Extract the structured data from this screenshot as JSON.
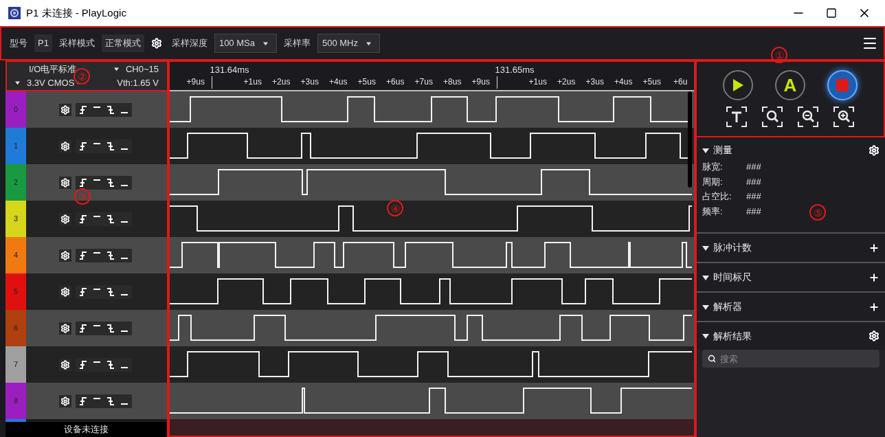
{
  "window": {
    "title": "P1 未连接 - PlayLogic"
  },
  "toolbar": {
    "items": [
      {
        "kind": "label",
        "text": "型号"
      },
      {
        "kind": "value",
        "text": "P1"
      },
      {
        "kind": "label",
        "text": "采样模式"
      },
      {
        "kind": "value",
        "text": "正常模式"
      },
      {
        "kind": "gear"
      },
      {
        "kind": "label",
        "text": "采样深度"
      },
      {
        "kind": "select",
        "text": "100 MSa"
      },
      {
        "kind": "label",
        "text": "采样率"
      },
      {
        "kind": "select",
        "text": "500 MHz"
      }
    ]
  },
  "io_panel": {
    "title": "I/O电平标准",
    "channels": "CH0~15",
    "standard": "3.3V CMOS -",
    "threshold": "Vth:1.65 V"
  },
  "channels": [
    {
      "number": "0",
      "color": "#9b1fc0"
    },
    {
      "number": "1",
      "color": "#1f7ad8"
    },
    {
      "number": "2",
      "color": "#1a9a40"
    },
    {
      "number": "3",
      "color": "#d6d61a"
    },
    {
      "number": "4",
      "color": "#f07a10"
    },
    {
      "number": "5",
      "color": "#e01010"
    },
    {
      "number": "6",
      "color": "#b04010"
    },
    {
      "number": "7",
      "color": "#a0a0a0"
    },
    {
      "number": "8",
      "color": "#9b1fc0"
    }
  ],
  "status": "设备未连接",
  "ruler": {
    "ticks": [
      {
        "label": "+9us",
        "kind": "minor"
      },
      {
        "label": "131.64ms",
        "kind": "major"
      },
      {
        "label": "+1us",
        "kind": "minor"
      },
      {
        "label": "+2us",
        "kind": "minor"
      },
      {
        "label": "+3us",
        "kind": "minor"
      },
      {
        "label": "+4us",
        "kind": "minor"
      },
      {
        "label": "+5us",
        "kind": "minor"
      },
      {
        "label": "+6us",
        "kind": "minor"
      },
      {
        "label": "+7us",
        "kind": "minor"
      },
      {
        "label": "+8us",
        "kind": "minor"
      },
      {
        "label": "+9us",
        "kind": "minor"
      },
      {
        "label": "131.65ms",
        "kind": "major"
      },
      {
        "label": "+1us",
        "kind": "minor"
      },
      {
        "label": "+2us",
        "kind": "minor"
      },
      {
        "label": "+3us",
        "kind": "minor"
      },
      {
        "label": "+4us",
        "kind": "minor"
      },
      {
        "label": "+5us",
        "kind": "minor"
      },
      {
        "label": "+6u",
        "kind": "minor"
      }
    ]
  },
  "run_controls": [
    {
      "kind": "play",
      "selected": false
    },
    {
      "kind": "auto",
      "text": "A",
      "selected": false
    },
    {
      "kind": "stop",
      "selected": true
    }
  ],
  "measure": {
    "title": "测量",
    "expanded": true,
    "rows": [
      {
        "label": "脉宽:",
        "value": "###"
      },
      {
        "label": "周期:",
        "value": "###"
      },
      {
        "label": "占空比:",
        "value": "###"
      },
      {
        "label": "频率:",
        "value": "###"
      }
    ]
  },
  "sections": [
    {
      "title": "脉冲计数",
      "expanded": true,
      "kind": "add"
    },
    {
      "title": "时间标尺",
      "expanded": true,
      "kind": "add"
    },
    {
      "title": "解析器",
      "expanded": true,
      "kind": "add"
    }
  ],
  "results": {
    "title": "解析结果",
    "expanded": true,
    "search": {
      "placeholder": "搜索"
    }
  },
  "annotations": [
    {
      "label": "①"
    },
    {
      "label": "②"
    },
    {
      "label": "③"
    },
    {
      "label": "④"
    },
    {
      "label": "⑤"
    }
  ]
}
